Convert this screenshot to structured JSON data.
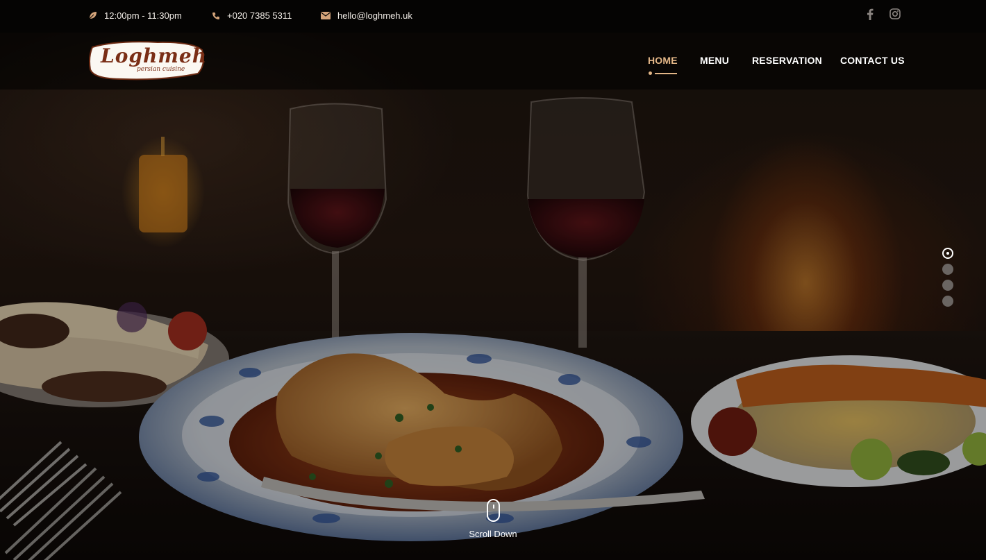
{
  "topbar": {
    "hours": "12:00pm - 11:30pm",
    "phone": "+020 7385 5311",
    "email": "hello@loghmeh.uk",
    "icons": {
      "hours": "leaf-icon",
      "phone": "phone-icon",
      "email": "envelope-icon"
    },
    "social": [
      "facebook-icon",
      "instagram-icon"
    ]
  },
  "logo": {
    "name": "Loghmeh",
    "tagline": "persian cuisine"
  },
  "nav": {
    "items": [
      {
        "label": "HOME",
        "active": true
      },
      {
        "label": "MENU",
        "active": false
      },
      {
        "label": "RESERVATION",
        "active": false
      },
      {
        "label": "CONTACT US",
        "active": false
      }
    ]
  },
  "slider": {
    "slide_count": 4,
    "active_index": 0
  },
  "scroll": {
    "label": "Scroll Down"
  },
  "colors": {
    "accent": "#e3b687",
    "icon": "#d4a47a",
    "topbar_bg": "#050403",
    "logo_text": "#7a2e16"
  }
}
